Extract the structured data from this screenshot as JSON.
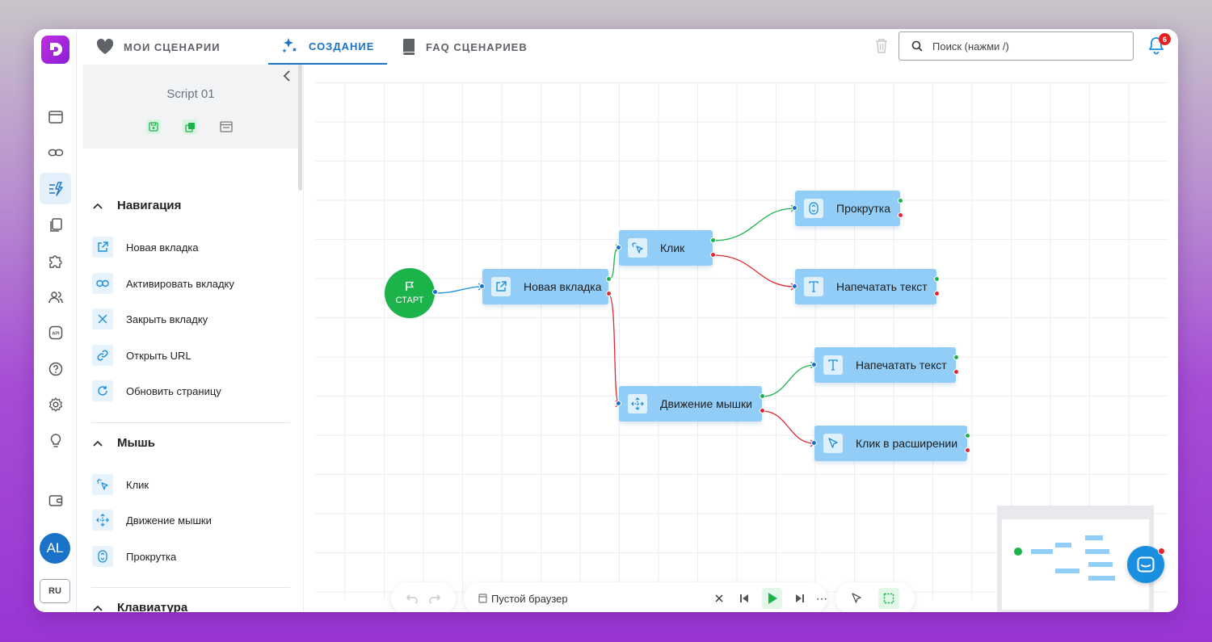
{
  "tabs": [
    {
      "label": "МОИ СЦЕНАРИИ",
      "icon": "heart-icon"
    },
    {
      "label": "СОЗДАНИЕ",
      "icon": "sparkles-icon"
    },
    {
      "label": "FAQ СЦЕНАРИЕВ",
      "icon": "book-icon"
    }
  ],
  "active_tab": "СОЗДАНИЕ",
  "search": {
    "placeholder": "Поиск (нажми /)"
  },
  "notifications": {
    "count": "6"
  },
  "rail": {
    "items": [
      "browser-icon",
      "link-icon",
      "flow-icon",
      "copy-icon",
      "puzzle-icon",
      "users-icon",
      "api-icon",
      "help-icon",
      "settings-icon",
      "lightbulb-icon",
      "wallet-icon"
    ],
    "active": "flow-icon",
    "avatar": "AL",
    "language": "RU"
  },
  "script": {
    "name": "Script 01"
  },
  "sections": [
    {
      "title": "Навигация",
      "items": [
        {
          "label": "Новая вкладка",
          "icon": "external-link-icon"
        },
        {
          "label": "Активировать вкладку",
          "icon": "link-icon"
        },
        {
          "label": "Закрыть вкладку",
          "icon": "close-icon"
        },
        {
          "label": "Открыть URL",
          "icon": "url-link-icon"
        },
        {
          "label": "Обновить страницу",
          "icon": "refresh-icon"
        }
      ]
    },
    {
      "title": "Мышь",
      "items": [
        {
          "label": "Клик",
          "icon": "click-icon"
        },
        {
          "label": "Движение мышки",
          "icon": "move-icon"
        },
        {
          "label": "Прокрутка",
          "icon": "scroll-icon"
        }
      ]
    },
    {
      "title": "Клавиатура",
      "items": []
    }
  ],
  "flow": {
    "start_label": "СТАРТ",
    "nodes": [
      {
        "id": "new_tab",
        "label": "Новая вкладка",
        "icon": "external-link-icon"
      },
      {
        "id": "click",
        "label": "Клик",
        "icon": "click-icon"
      },
      {
        "id": "scroll",
        "label": "Прокрутка",
        "icon": "scroll-icon"
      },
      {
        "id": "type1",
        "label": "Напечатать текст",
        "icon": "text-icon"
      },
      {
        "id": "mouse_move",
        "label": "Движение мышки",
        "icon": "move-icon"
      },
      {
        "id": "type2",
        "label": "Напечатать текст",
        "icon": "text-icon"
      },
      {
        "id": "ext_click",
        "label": "Клик в расширении",
        "icon": "cursor-icon"
      }
    ],
    "edges": [
      {
        "from": "start",
        "to": "new_tab",
        "type": "flow"
      },
      {
        "from": "new_tab",
        "to": "click",
        "type": "success"
      },
      {
        "from": "new_tab",
        "to": "mouse_move",
        "type": "error"
      },
      {
        "from": "click",
        "to": "scroll",
        "type": "success"
      },
      {
        "from": "click",
        "to": "type1",
        "type": "error"
      },
      {
        "from": "mouse_move",
        "to": "type2",
        "type": "success"
      },
      {
        "from": "mouse_move",
        "to": "ext_click",
        "type": "error"
      }
    ]
  },
  "toolbar": {
    "browser_label": "Пустой браузер"
  },
  "colors": {
    "accent": "#1a73c8",
    "node": "#91cdf7",
    "success": "#1db34b",
    "error": "#e5252f"
  }
}
